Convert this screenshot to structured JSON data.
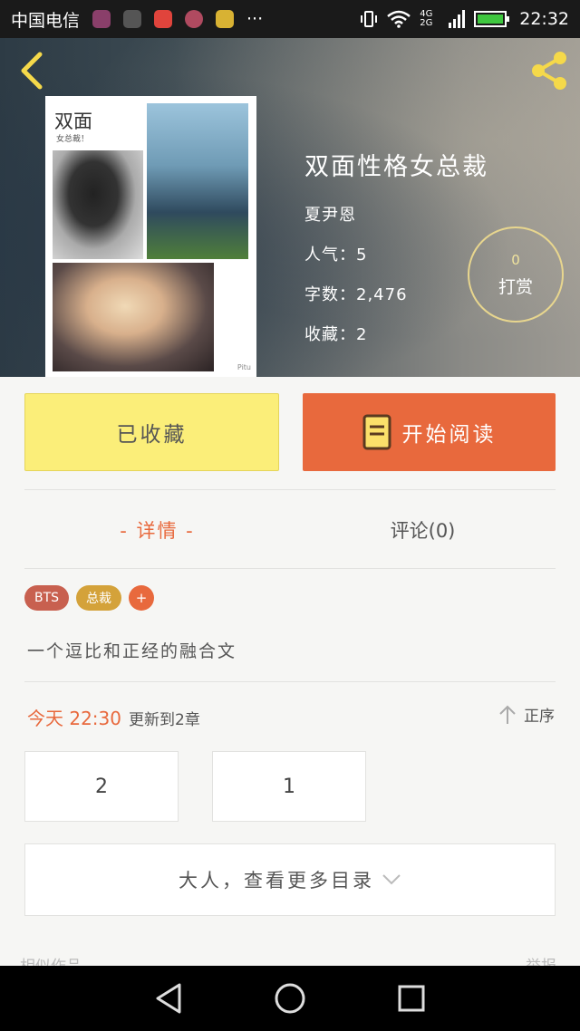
{
  "status_bar": {
    "carrier": "中国电信",
    "network": "4G 2G",
    "time": "22:32",
    "more": "···"
  },
  "book": {
    "title": "双面性格女总裁",
    "author": "夏尹恩",
    "popularity": "人气：5",
    "word_count": "字数：2,476",
    "favorites": "收藏：2",
    "cover": {
      "title": "双面",
      "subtitle": "女总裁！",
      "watermark": "Pitu"
    }
  },
  "tip": {
    "count": "0",
    "label": "打赏"
  },
  "actions": {
    "favorited_label": "已收藏",
    "read_label": "开始阅读"
  },
  "tabs": [
    {
      "label": "- 详情 -"
    },
    {
      "label": "评论(0)"
    }
  ],
  "tags": [
    {
      "label": "BTS",
      "color": "#c8604f"
    },
    {
      "label": "总裁",
      "color": "#d4a23a"
    }
  ],
  "tag_add_label": "+",
  "description": "一个逗比和正经的融合文",
  "update": {
    "time": "今天 22:30",
    "message": "更新到2章",
    "order_label": "正序"
  },
  "chapters": [
    {
      "label": "2"
    },
    {
      "label": "1"
    }
  ],
  "more_chapters_label": "大人，查看更多目录",
  "footer": {
    "similar_label": "相似作品",
    "report_label": "举报"
  },
  "colors": {
    "accent": "#e8693d",
    "favorite_button": "#fbee79",
    "tip_ring": "#e8d68e"
  }
}
